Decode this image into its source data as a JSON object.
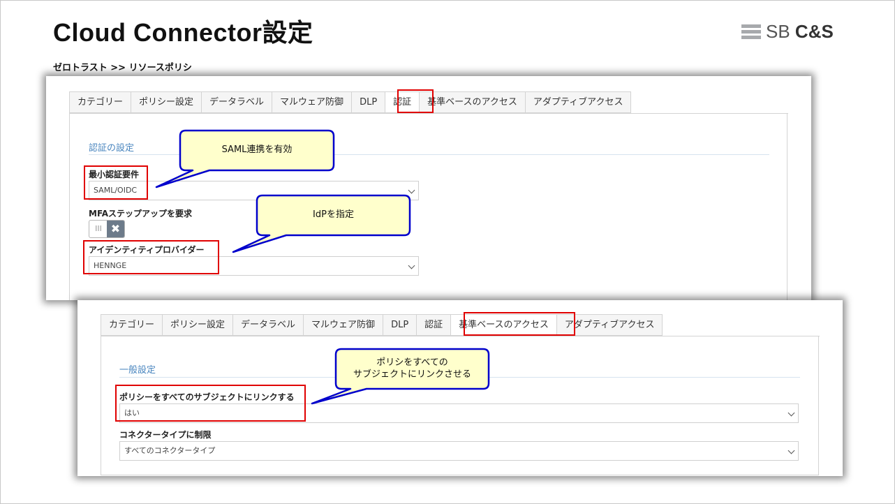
{
  "header": {
    "title": "Cloud Connector設定",
    "logo_prefix": "SB ",
    "logo_suffix": "C&S",
    "breadcrumb": "ゼロトラスト >> リソースポリシ"
  },
  "tabs": [
    "カテゴリー",
    "ポリシー設定",
    "データラベル",
    "マルウェア防御",
    "DLP",
    "認証",
    "基準ベースのアクセス",
    "アダプティブアクセス"
  ],
  "panel_auth": {
    "active_tab": "認証",
    "section_title": "認証の設定",
    "min_auth_label": "最小認証要件",
    "min_auth_value": "SAML/OIDC",
    "mfa_label": "MFAステップアップを要求",
    "mfa_toggle_on": "III",
    "mfa_toggle_off": "✖",
    "idp_label": "アイデンティティプロバイダー",
    "idp_value": "HENNGE"
  },
  "panel_access": {
    "active_tab": "基準ベースのアクセス",
    "section_title": "一般設定",
    "link_label": "ポリシーをすべてのサブジェクトにリンクする",
    "link_value": "はい",
    "connector_label": "コネクタータイプに制限",
    "connector_value": "すべてのコネクタータイプ"
  },
  "callouts": {
    "saml": "SAML連携を有効",
    "idp": "IdPを指定",
    "policy_line1": "ポリシをすべての",
    "policy_line2": "サブジェクトにリンクさせる"
  },
  "colors": {
    "highlight": "#e00000",
    "callout_fill": "#ffffcc",
    "callout_border": "#0000cc",
    "section_title": "#4a86bf"
  }
}
